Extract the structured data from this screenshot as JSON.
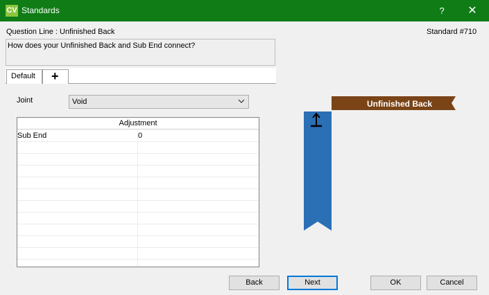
{
  "window": {
    "icon_text": "CV",
    "title": "Standards",
    "help_label": "?",
    "close_label": "✕"
  },
  "header": {
    "question_line": "Question Line : Unfinished Back",
    "standard": "Standard #710",
    "question": "How does your Unfinished Back and Sub End connect?"
  },
  "tabs": [
    {
      "label": "Default"
    },
    {
      "label": "+"
    }
  ],
  "joint": {
    "label": "Joint",
    "value": "Void"
  },
  "adjustment": {
    "header": "Adjustment",
    "rows": [
      {
        "name": "Sub End",
        "value": "0"
      }
    ]
  },
  "diagram": {
    "back_label": "Unfinished Back",
    "back_color": "#7a4417",
    "sub_end_color": "#2b6fb5"
  },
  "buttons": {
    "back": "Back",
    "next": "Next",
    "ok": "OK",
    "cancel": "Cancel"
  }
}
